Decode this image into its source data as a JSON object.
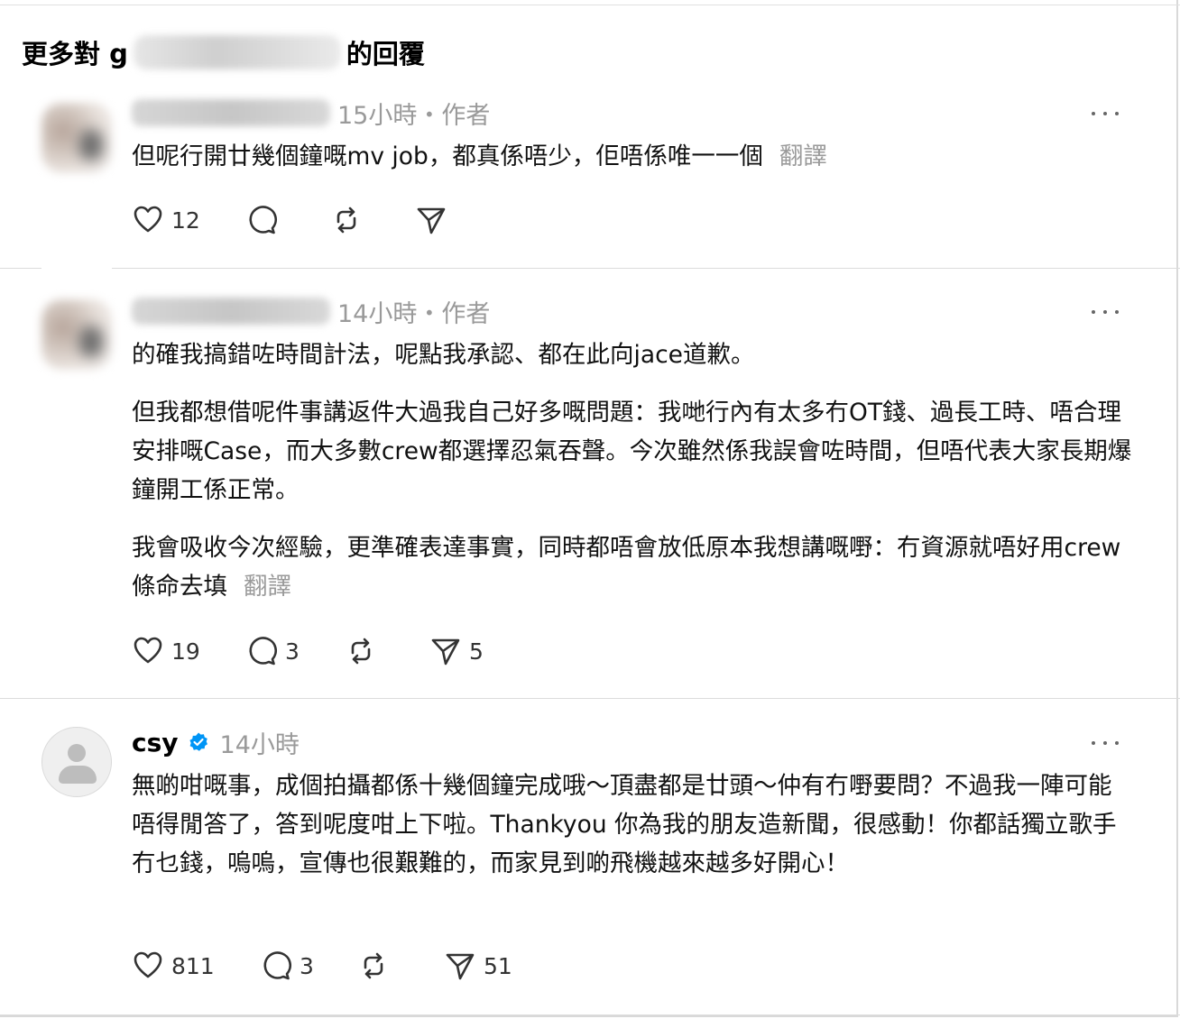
{
  "header": {
    "prefix": "更多對 g",
    "suffix": "的回覆"
  },
  "posts": [
    {
      "author_visible": "",
      "time": "15小時・作者",
      "paragraphs": [
        "但呢行開廿幾個鐘嘅mv job，都真係唔少，佢唔係唯一一個"
      ],
      "translate": "翻譯",
      "likes": "12",
      "comments": "",
      "reposts": "",
      "shares": ""
    },
    {
      "author_visible": "",
      "time": "14小時・作者",
      "paragraphs": [
        "的確我搞錯咗時間計法，呢點我承認、都在此向jace道歉。",
        "但我都想借呢件事講返件大過我自己好多嘅問題：我哋行內有太多冇OT錢、過長工時、唔合理安排嘅Case，而大多數crew都選擇忍氣吞聲。今次雖然係我誤會咗時間，但唔代表大家長期爆鐘開工係正常。",
        "我會吸收今次經驗，更準確表達事實，同時都唔會放低原本我想講嘅嘢：冇資源就唔好用crew條命去填"
      ],
      "translate": "翻譯",
      "likes": "19",
      "comments": "3",
      "reposts": "",
      "shares": "5"
    },
    {
      "author_visible": "csy",
      "time": "14小時",
      "paragraphs": [
        "無啲咁嘅事，成個拍攝都係十幾個鐘完成哦～頂盡都是廿頭～仲有冇嘢要問？不過我一陣可能唔得閒答了，答到呢度咁上下啦。Thankyou 你為我的朋友造新聞，很感動！你都話獨立歌手冇乜錢，嗚嗚，宣傳也很艱難的，而家見到啲飛機越來越多好開心！"
      ],
      "translate": "",
      "likes": "811",
      "comments": "3",
      "reposts": "",
      "shares": "51"
    }
  ],
  "colors": {
    "verified": "#0095f6",
    "muted": "#9a9a9a",
    "divider": "#dcdcdc"
  },
  "icons": [
    "heart-icon",
    "comment-icon",
    "repost-icon",
    "share-icon",
    "more-icon",
    "verified-badge-icon"
  ]
}
